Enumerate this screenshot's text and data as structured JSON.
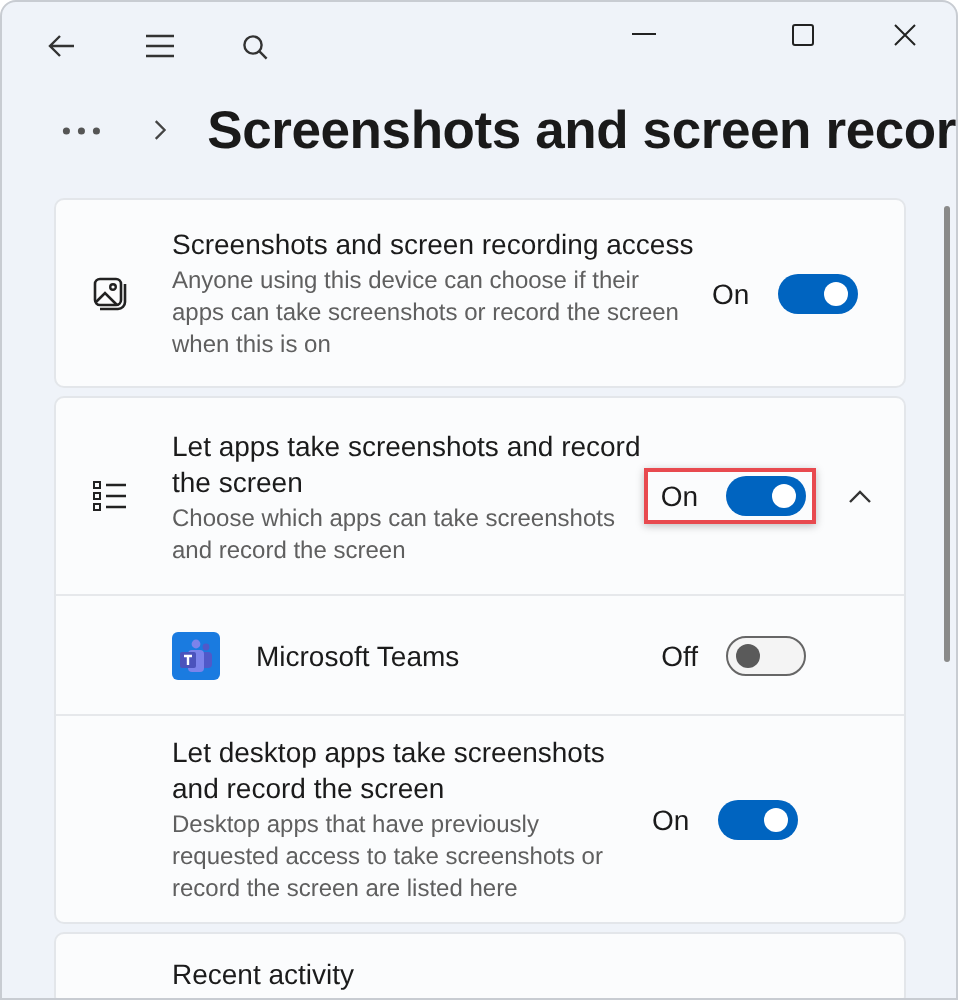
{
  "page": {
    "title": "Screenshots and screen recor"
  },
  "cards": [
    {
      "kind": "toggle",
      "title": "Screenshots and screen recording access",
      "description": "Anyone using this device can choose if their apps can take screenshots or record the screen when this is on",
      "state_label": "On",
      "on": true
    },
    {
      "kind": "expander",
      "title": "Let apps take screenshots and record the screen",
      "description": "Choose which apps can take screenshots and record the screen",
      "state_label": "On",
      "on": true,
      "highlighted": true,
      "expanded": true,
      "children": [
        {
          "kind": "app",
          "title": "Microsoft Teams",
          "state_label": "Off",
          "on": false
        },
        {
          "kind": "toggle",
          "title": "Let desktop apps take screenshots and record the screen",
          "description": "Desktop apps that have previously requested access to take screenshots or record the screen are listed here",
          "state_label": "On",
          "on": true
        }
      ]
    },
    {
      "kind": "heading",
      "title": "Recent activity"
    }
  ]
}
